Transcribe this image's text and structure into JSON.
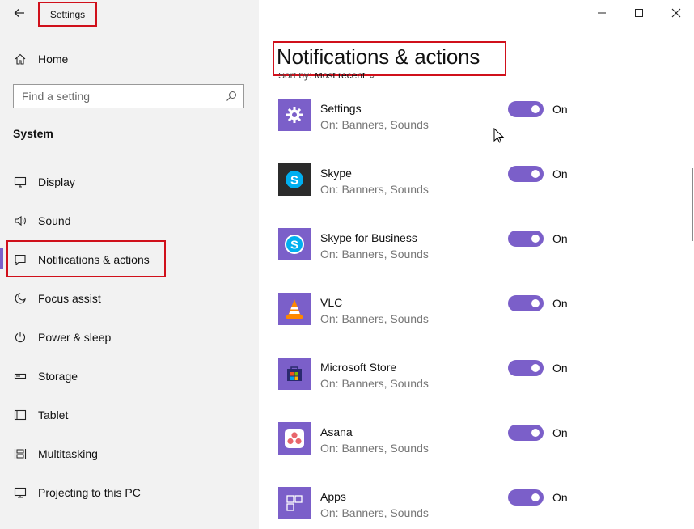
{
  "window": {
    "title": "Settings",
    "minimize_glyph": "—",
    "maximize_glyph": "☐",
    "close_glyph": "✕"
  },
  "sidebar": {
    "home_label": "Home",
    "search_placeholder": "Find a setting",
    "section_title": "System",
    "items": [
      {
        "label": "Display",
        "icon": "display-icon"
      },
      {
        "label": "Sound",
        "icon": "sound-icon"
      },
      {
        "label": "Notifications & actions",
        "icon": "notifications-icon",
        "active": true
      },
      {
        "label": "Focus assist",
        "icon": "moon-icon"
      },
      {
        "label": "Power & sleep",
        "icon": "power-icon"
      },
      {
        "label": "Storage",
        "icon": "storage-icon"
      },
      {
        "label": "Tablet",
        "icon": "tablet-icon"
      },
      {
        "label": "Multitasking",
        "icon": "multitasking-icon"
      },
      {
        "label": "Projecting to this PC",
        "icon": "projecting-icon"
      }
    ]
  },
  "main": {
    "page_title": "Notifications & actions",
    "sort_by_label": "Sort by:",
    "sort_by_value": "Most recent",
    "apps": [
      {
        "name": "Settings",
        "status": "On: Banners, Sounds",
        "toggle": "On",
        "icon": "settings-gear-icon",
        "tile_color": "#7b5fc9"
      },
      {
        "name": "Skype",
        "status": "On: Banners, Sounds",
        "toggle": "On",
        "icon": "skype-icon",
        "tile_color": "#2b2b2b"
      },
      {
        "name": "Skype for Business",
        "status": "On: Banners, Sounds",
        "toggle": "On",
        "icon": "skype-business-icon",
        "tile_color": "#7b5fc9"
      },
      {
        "name": "VLC",
        "status": "On: Banners, Sounds",
        "toggle": "On",
        "icon": "vlc-cone-icon",
        "tile_color": "#7b5fc9"
      },
      {
        "name": "Microsoft Store",
        "status": "On: Banners, Sounds",
        "toggle": "On",
        "icon": "store-bag-icon",
        "tile_color": "#7b5fc9"
      },
      {
        "name": "Asana",
        "status": "On: Banners, Sounds",
        "toggle": "On",
        "icon": "asana-icon",
        "tile_color": "#7b5fc9"
      },
      {
        "name": "Apps",
        "status": "On: Banners, Sounds",
        "toggle": "On",
        "icon": "apps-grid-icon",
        "tile_color": "#7b5fc9"
      }
    ]
  },
  "colors": {
    "accent": "#7b5fc9",
    "highlight_box": "#d0101b",
    "sidebar_bg": "#f2f2f2"
  }
}
